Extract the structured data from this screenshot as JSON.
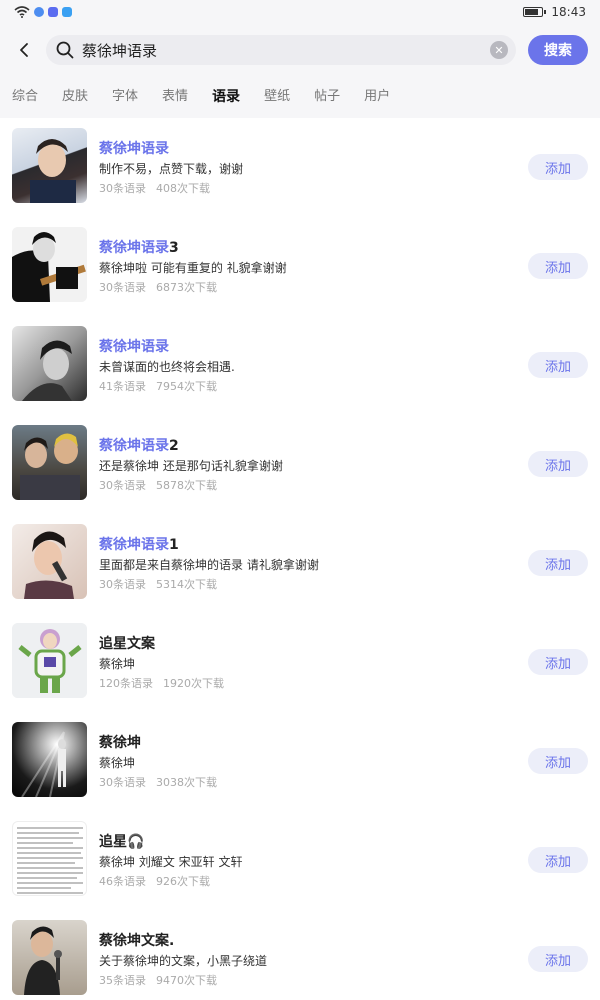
{
  "status_bar": {
    "time": "18:43",
    "icons": [
      "wifi-icon",
      "chat-icon",
      "baby-icon",
      "search-app-icon"
    ],
    "battery_level": 0.7
  },
  "search": {
    "query": "蔡徐坤语录",
    "button_label": "搜索"
  },
  "tabs": [
    {
      "label": "综合",
      "active": false
    },
    {
      "label": "皮肤",
      "active": false
    },
    {
      "label": "字体",
      "active": false
    },
    {
      "label": "表情",
      "active": false
    },
    {
      "label": "语录",
      "active": true
    },
    {
      "label": "壁纸",
      "active": false
    },
    {
      "label": "帖子",
      "active": false
    },
    {
      "label": "用户",
      "active": false
    }
  ],
  "accent_color": "#6b74ea",
  "add_label": "添加",
  "results": [
    {
      "title_hl": "蔡徐坤语录",
      "title_rest": "",
      "desc": "制作不易，点赞下载，谢谢",
      "count": "30条语录",
      "downloads": "408次下载",
      "thumb": "portrait-photo"
    },
    {
      "title_hl": "蔡徐坤语录",
      "title_rest": "3",
      "desc": "蔡徐坤啦 可能有重复的 礼貌拿谢谢",
      "count": "30条语录",
      "downloads": "6873次下载",
      "thumb": "guitar-photo"
    },
    {
      "title_hl": "蔡徐坤语录",
      "title_rest": "",
      "desc": "未曾谋面的也终将会相遇.",
      "count": "41条语录",
      "downloads": "7954次下载",
      "thumb": "bw-portrait-photo"
    },
    {
      "title_hl": "蔡徐坤语录",
      "title_rest": "2",
      "desc": "还是蔡徐坤 还是那句话礼貌拿谢谢",
      "count": "30条语录",
      "downloads": "5878次下载",
      "thumb": "group-photo"
    },
    {
      "title_hl": "蔡徐坤语录",
      "title_rest": "1",
      "desc": "里面都是来自蔡徐坤的语录 请礼貌拿谢谢",
      "count": "30条语录",
      "downloads": "5314次下载",
      "thumb": "microphone-photo"
    },
    {
      "title_hl": "",
      "title_rest": "追星文案",
      "desc": "蔡徐坤",
      "count": "120条语录",
      "downloads": "1920次下载",
      "thumb": "toy-figure-photo"
    },
    {
      "title_hl": "",
      "title_rest": "蔡徐坤",
      "desc": "蔡徐坤",
      "count": "30条语录",
      "downloads": "3038次下载",
      "thumb": "stage-light-photo"
    },
    {
      "title_hl": "",
      "title_rest": "追星🎧",
      "desc": "蔡徐坤 刘耀文 宋亚轩 文轩",
      "count": "46条语录",
      "downloads": "926次下载",
      "thumb": "text-screenshot"
    },
    {
      "title_hl": "",
      "title_rest": "蔡徐坤文案.",
      "desc": "关于蔡徐坤的文案，小黑子绕道",
      "count": "35条语录",
      "downloads": "9470次下载",
      "thumb": "street-photo"
    }
  ]
}
